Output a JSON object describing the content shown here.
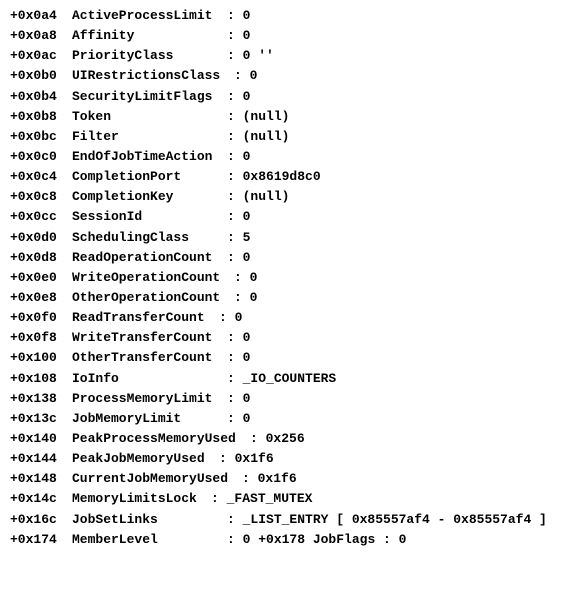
{
  "rows": [
    {
      "offset": "+0x0a4",
      "name": "ActiveProcessLimit",
      "value": "0",
      "nameWidth": "155px",
      "extra": ""
    },
    {
      "offset": "+0x0a8",
      "name": "Affinity",
      "value": "0",
      "nameWidth": "155px",
      "extra": ""
    },
    {
      "offset": "+0x0ac",
      "name": "PriorityClass",
      "value": "0 ''",
      "nameWidth": "155px",
      "extra": ""
    },
    {
      "offset": "+0x0b0",
      "name": "UIRestrictionsClass",
      "value": "0",
      "nameWidth": "162px",
      "extra": ""
    },
    {
      "offset": "+0x0b4",
      "name": "SecurityLimitFlags",
      "value": "0",
      "nameWidth": "155px",
      "extra": ""
    },
    {
      "offset": "+0x0b8",
      "name": "Token",
      "value": "(null)",
      "nameWidth": "155px",
      "extra": ""
    },
    {
      "offset": "+0x0bc",
      "name": "Filter",
      "value": "(null)",
      "nameWidth": "155px",
      "extra": ""
    },
    {
      "offset": "+0x0c0",
      "name": "EndOfJobTimeAction",
      "value": "0",
      "nameWidth": "155px",
      "extra": ""
    },
    {
      "offset": "+0x0c4",
      "name": "CompletionPort",
      "value": "0x8619d8c0",
      "nameWidth": "155px",
      "extra": ""
    },
    {
      "offset": "+0x0c8",
      "name": "CompletionKey",
      "value": "(null)",
      "nameWidth": "155px",
      "extra": ""
    },
    {
      "offset": "+0x0cc",
      "name": "SessionId",
      "value": "0",
      "nameWidth": "155px",
      "extra": ""
    },
    {
      "offset": "+0x0d0",
      "name": "SchedulingClass",
      "value": "5",
      "nameWidth": "155px",
      "extra": ""
    },
    {
      "offset": "+0x0d8",
      "name": "ReadOperationCount",
      "value": "0",
      "nameWidth": "155px",
      "extra": ""
    },
    {
      "offset": "+0x0e0",
      "name": "WriteOperationCount",
      "value": "0",
      "nameWidth": "162px",
      "extra": ""
    },
    {
      "offset": "+0x0e8",
      "name": "OtherOperationCount",
      "value": "0",
      "nameWidth": "162px",
      "extra": ""
    },
    {
      "offset": "+0x0f0",
      "name": "ReadTransferCount",
      "value": "0",
      "nameWidth": "147px",
      "extra": ""
    },
    {
      "offset": "+0x0f8",
      "name": "WriteTransferCount",
      "value": "0",
      "nameWidth": "155px",
      "extra": ""
    },
    {
      "offset": "+0x100",
      "name": "OtherTransferCount",
      "value": "0",
      "nameWidth": "155px",
      "extra": ""
    },
    {
      "offset": "+0x108",
      "name": "IoInfo",
      "value": "_IO_COUNTERS",
      "nameWidth": "155px",
      "extra": ""
    },
    {
      "offset": "+0x138",
      "name": "ProcessMemoryLimit",
      "value": "0",
      "nameWidth": "155px",
      "extra": ""
    },
    {
      "offset": "+0x13c",
      "name": "JobMemoryLimit",
      "value": "0",
      "nameWidth": "155px",
      "extra": ""
    },
    {
      "offset": "+0x140",
      "name": "PeakProcessMemoryUsed",
      "value": "0x256",
      "nameWidth": "178px",
      "extra": ""
    },
    {
      "offset": "+0x144",
      "name": "PeakJobMemoryUsed",
      "value": "0x1f6",
      "nameWidth": "147px",
      "extra": ""
    },
    {
      "offset": "+0x148",
      "name": "CurrentJobMemoryUsed",
      "value": "0x1f6",
      "nameWidth": "170px",
      "extra": ""
    },
    {
      "offset": "+0x14c",
      "name": "MemoryLimitsLock",
      "value": "_FAST_MUTEX",
      "nameWidth": "139px",
      "extra": ""
    },
    {
      "offset": "+0x16c",
      "name": "JobSetLinks",
      "value": "_LIST_ENTRY [ 0x85557af4 - 0x85557af4 ]",
      "nameWidth": "155px",
      "extra": ""
    },
    {
      "offset": "+0x174",
      "name": "MemberLevel",
      "value": "0",
      "nameWidth": "155px",
      "extra": "   +0x178 JobFlags         : 0"
    }
  ]
}
